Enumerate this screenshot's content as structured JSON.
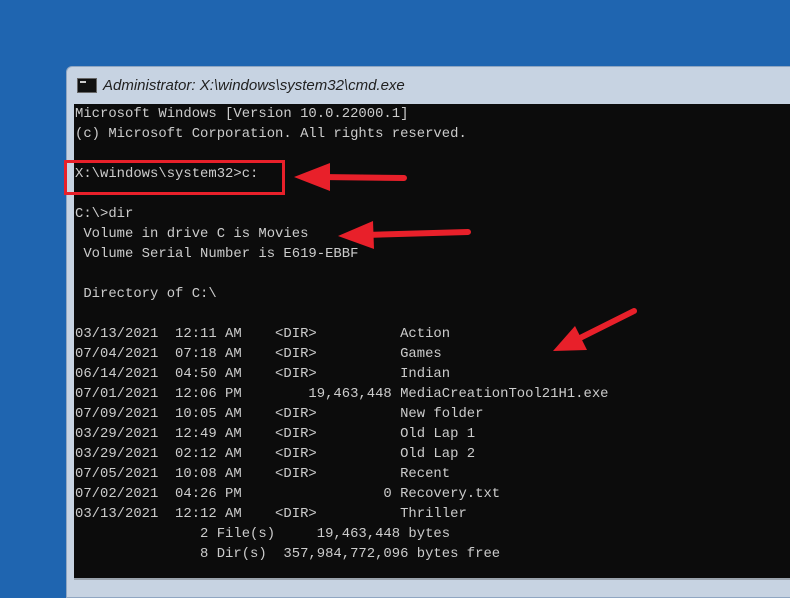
{
  "window": {
    "title": "Administrator: X:\\windows\\system32\\cmd.exe"
  },
  "console": {
    "header": [
      "Microsoft Windows [Version 10.0.22000.1]",
      "(c) Microsoft Corporation. All rights reserved."
    ],
    "prompt1": "X:\\windows\\system32>c:",
    "prompt2": "C:\\>dir",
    "volume": " Volume in drive C is Movies",
    "serial": " Volume Serial Number is E619-EBBF",
    "directory_of": " Directory of C:\\",
    "entries": [
      {
        "date": "03/13/2021",
        "time": "12:11 AM",
        "type": "<DIR>",
        "size": "",
        "name": "Action"
      },
      {
        "date": "07/04/2021",
        "time": "07:18 AM",
        "type": "<DIR>",
        "size": "",
        "name": "Games"
      },
      {
        "date": "06/14/2021",
        "time": "04:50 AM",
        "type": "<DIR>",
        "size": "",
        "name": "Indian"
      },
      {
        "date": "07/01/2021",
        "time": "12:06 PM",
        "type": "",
        "size": "19,463,448",
        "name": "MediaCreationTool21H1.exe"
      },
      {
        "date": "07/09/2021",
        "time": "10:05 AM",
        "type": "<DIR>",
        "size": "",
        "name": "New folder"
      },
      {
        "date": "03/29/2021",
        "time": "12:49 AM",
        "type": "<DIR>",
        "size": "",
        "name": "Old Lap 1"
      },
      {
        "date": "03/29/2021",
        "time": "02:12 AM",
        "type": "<DIR>",
        "size": "",
        "name": "Old Lap 2"
      },
      {
        "date": "07/05/2021",
        "time": "10:08 AM",
        "type": "<DIR>",
        "size": "",
        "name": "Recent"
      },
      {
        "date": "07/02/2021",
        "time": "04:26 PM",
        "type": "",
        "size": "0",
        "name": "Recovery.txt"
      },
      {
        "date": "03/13/2021",
        "time": "12:12 AM",
        "type": "<DIR>",
        "size": "",
        "name": "Thriller"
      }
    ],
    "summary_files": "               2 File(s)     19,463,448 bytes",
    "summary_dirs": "               8 Dir(s)  357,984,772,096 bytes free"
  },
  "colors": {
    "annotation": "#e8202a",
    "desktop": "#1f65b0"
  }
}
